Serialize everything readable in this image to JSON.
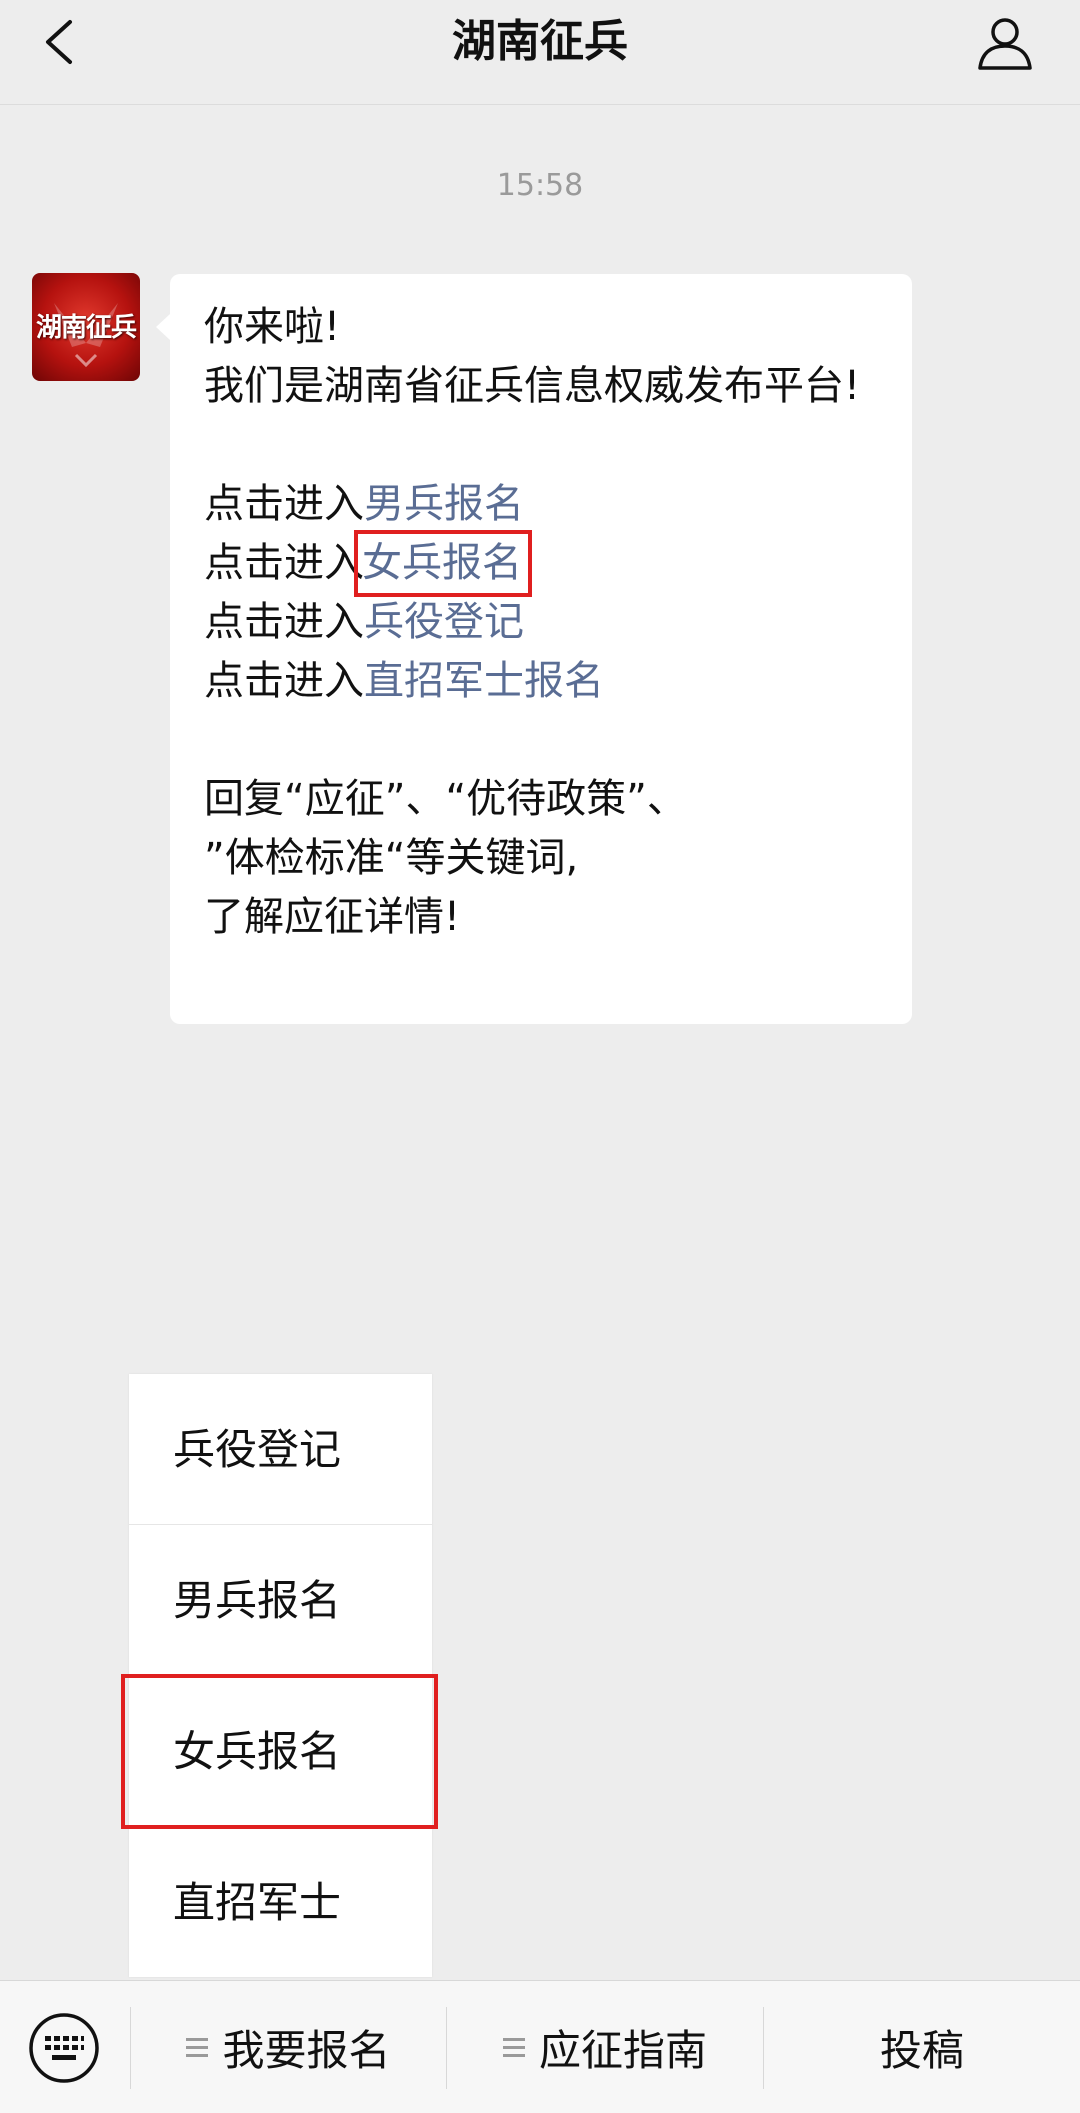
{
  "header": {
    "title": "湖南征兵",
    "back_icon": "chevron-left-icon",
    "profile_icon": "person-icon"
  },
  "chat": {
    "timestamp": "15:58",
    "avatar_text": "湖南征兵",
    "message": {
      "greeting": "你来啦!",
      "intro": "我们是湖南省征兵信息权威发布平台!",
      "prefix": "点击进入",
      "links": [
        "男兵报名",
        "女兵报名",
        "兵役登记",
        "直招军士报名"
      ],
      "reply_line1": "回复“应征”、“优待政策”、",
      "reply_line2": "”体检标准“等关键词,",
      "reply_line3": "了解应征详情!"
    }
  },
  "popup_menu": {
    "items": [
      "兵役登记",
      "男兵报名",
      "女兵报名",
      "直招军士"
    ]
  },
  "bottom_bar": {
    "keyboard_icon": "keyboard-icon",
    "menu1": "我要报名",
    "menu2": "应征指南",
    "menu3": "投稿"
  },
  "colors": {
    "background": "#ededed",
    "link": "#5a6d94",
    "highlight": "#e01f1f"
  }
}
